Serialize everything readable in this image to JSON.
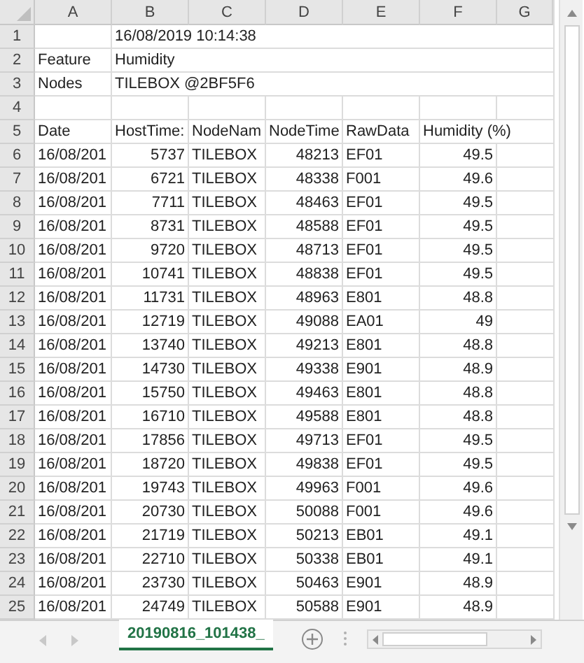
{
  "columns": [
    "A",
    "B",
    "C",
    "D",
    "E",
    "F",
    "G"
  ],
  "rows": [
    {
      "row": "1",
      "B": {
        "text": "16/08/2019 10:14:38",
        "kind": "text"
      }
    },
    {
      "row": "2",
      "A": {
        "text": "Feature",
        "kind": "text"
      },
      "B": {
        "text": "Humidity",
        "kind": "text"
      }
    },
    {
      "row": "3",
      "A": {
        "text": "Nodes",
        "kind": "text"
      },
      "B": {
        "text": "TILEBOX @2BF5F6",
        "kind": "text"
      }
    },
    {
      "row": "4"
    },
    {
      "row": "5",
      "A": {
        "text": "Date",
        "kind": "text"
      },
      "B": {
        "text": "HostTime:",
        "kind": "text"
      },
      "C": {
        "text": "NodeNam",
        "kind": "text"
      },
      "D": {
        "text": "NodeTime",
        "kind": "text"
      },
      "E": {
        "text": "RawData",
        "kind": "text"
      },
      "F": {
        "text": "Humidity (%)",
        "kind": "text"
      }
    },
    {
      "row": "6",
      "A": {
        "text": "16/08/201",
        "kind": "text"
      },
      "B": {
        "text": "5737",
        "kind": "number"
      },
      "C": {
        "text": "TILEBOX",
        "kind": "text"
      },
      "D": {
        "text": "48213",
        "kind": "number"
      },
      "E": {
        "text": "EF01",
        "kind": "text"
      },
      "F": {
        "text": "49.5",
        "kind": "number"
      }
    },
    {
      "row": "7",
      "A": {
        "text": "16/08/201",
        "kind": "text"
      },
      "B": {
        "text": "6721",
        "kind": "number"
      },
      "C": {
        "text": "TILEBOX",
        "kind": "text"
      },
      "D": {
        "text": "48338",
        "kind": "number"
      },
      "E": {
        "text": "F001",
        "kind": "text"
      },
      "F": {
        "text": "49.6",
        "kind": "number"
      }
    },
    {
      "row": "8",
      "A": {
        "text": "16/08/201",
        "kind": "text"
      },
      "B": {
        "text": "7711",
        "kind": "number"
      },
      "C": {
        "text": "TILEBOX",
        "kind": "text"
      },
      "D": {
        "text": "48463",
        "kind": "number"
      },
      "E": {
        "text": "EF01",
        "kind": "text"
      },
      "F": {
        "text": "49.5",
        "kind": "number"
      }
    },
    {
      "row": "9",
      "A": {
        "text": "16/08/201",
        "kind": "text"
      },
      "B": {
        "text": "8731",
        "kind": "number"
      },
      "C": {
        "text": "TILEBOX",
        "kind": "text"
      },
      "D": {
        "text": "48588",
        "kind": "number"
      },
      "E": {
        "text": "EF01",
        "kind": "text"
      },
      "F": {
        "text": "49.5",
        "kind": "number"
      }
    },
    {
      "row": "10",
      "A": {
        "text": "16/08/201",
        "kind": "text"
      },
      "B": {
        "text": "9720",
        "kind": "number"
      },
      "C": {
        "text": "TILEBOX",
        "kind": "text"
      },
      "D": {
        "text": "48713",
        "kind": "number"
      },
      "E": {
        "text": "EF01",
        "kind": "text"
      },
      "F": {
        "text": "49.5",
        "kind": "number"
      }
    },
    {
      "row": "11",
      "A": {
        "text": "16/08/201",
        "kind": "text"
      },
      "B": {
        "text": "10741",
        "kind": "number"
      },
      "C": {
        "text": "TILEBOX",
        "kind": "text"
      },
      "D": {
        "text": "48838",
        "kind": "number"
      },
      "E": {
        "text": "EF01",
        "kind": "text"
      },
      "F": {
        "text": "49.5",
        "kind": "number"
      }
    },
    {
      "row": "12",
      "A": {
        "text": "16/08/201",
        "kind": "text"
      },
      "B": {
        "text": "11731",
        "kind": "number"
      },
      "C": {
        "text": "TILEBOX",
        "kind": "text"
      },
      "D": {
        "text": "48963",
        "kind": "number"
      },
      "E": {
        "text": "E801",
        "kind": "text"
      },
      "F": {
        "text": "48.8",
        "kind": "number"
      }
    },
    {
      "row": "13",
      "A": {
        "text": "16/08/201",
        "kind": "text"
      },
      "B": {
        "text": "12719",
        "kind": "number"
      },
      "C": {
        "text": "TILEBOX",
        "kind": "text"
      },
      "D": {
        "text": "49088",
        "kind": "number"
      },
      "E": {
        "text": "EA01",
        "kind": "text"
      },
      "F": {
        "text": "49",
        "kind": "number"
      }
    },
    {
      "row": "14",
      "A": {
        "text": "16/08/201",
        "kind": "text"
      },
      "B": {
        "text": "13740",
        "kind": "number"
      },
      "C": {
        "text": "TILEBOX",
        "kind": "text"
      },
      "D": {
        "text": "49213",
        "kind": "number"
      },
      "E": {
        "text": "E801",
        "kind": "text"
      },
      "F": {
        "text": "48.8",
        "kind": "number"
      }
    },
    {
      "row": "15",
      "A": {
        "text": "16/08/201",
        "kind": "text"
      },
      "B": {
        "text": "14730",
        "kind": "number"
      },
      "C": {
        "text": "TILEBOX",
        "kind": "text"
      },
      "D": {
        "text": "49338",
        "kind": "number"
      },
      "E": {
        "text": "E901",
        "kind": "text"
      },
      "F": {
        "text": "48.9",
        "kind": "number"
      }
    },
    {
      "row": "16",
      "A": {
        "text": "16/08/201",
        "kind": "text"
      },
      "B": {
        "text": "15750",
        "kind": "number"
      },
      "C": {
        "text": "TILEBOX",
        "kind": "text"
      },
      "D": {
        "text": "49463",
        "kind": "number"
      },
      "E": {
        "text": "E801",
        "kind": "text"
      },
      "F": {
        "text": "48.8",
        "kind": "number"
      }
    },
    {
      "row": "17",
      "A": {
        "text": "16/08/201",
        "kind": "text"
      },
      "B": {
        "text": "16710",
        "kind": "number"
      },
      "C": {
        "text": "TILEBOX",
        "kind": "text"
      },
      "D": {
        "text": "49588",
        "kind": "number"
      },
      "E": {
        "text": "E801",
        "kind": "text"
      },
      "F": {
        "text": "48.8",
        "kind": "number"
      }
    },
    {
      "row": "18",
      "A": {
        "text": "16/08/201",
        "kind": "text"
      },
      "B": {
        "text": "17856",
        "kind": "number"
      },
      "C": {
        "text": "TILEBOX",
        "kind": "text"
      },
      "D": {
        "text": "49713",
        "kind": "number"
      },
      "E": {
        "text": "EF01",
        "kind": "text"
      },
      "F": {
        "text": "49.5",
        "kind": "number"
      }
    },
    {
      "row": "19",
      "A": {
        "text": "16/08/201",
        "kind": "text"
      },
      "B": {
        "text": "18720",
        "kind": "number"
      },
      "C": {
        "text": "TILEBOX",
        "kind": "text"
      },
      "D": {
        "text": "49838",
        "kind": "number"
      },
      "E": {
        "text": "EF01",
        "kind": "text"
      },
      "F": {
        "text": "49.5",
        "kind": "number"
      }
    },
    {
      "row": "20",
      "A": {
        "text": "16/08/201",
        "kind": "text"
      },
      "B": {
        "text": "19743",
        "kind": "number"
      },
      "C": {
        "text": "TILEBOX",
        "kind": "text"
      },
      "D": {
        "text": "49963",
        "kind": "number"
      },
      "E": {
        "text": "F001",
        "kind": "text"
      },
      "F": {
        "text": "49.6",
        "kind": "number"
      }
    },
    {
      "row": "21",
      "A": {
        "text": "16/08/201",
        "kind": "text"
      },
      "B": {
        "text": "20730",
        "kind": "number"
      },
      "C": {
        "text": "TILEBOX",
        "kind": "text"
      },
      "D": {
        "text": "50088",
        "kind": "number"
      },
      "E": {
        "text": "F001",
        "kind": "text"
      },
      "F": {
        "text": "49.6",
        "kind": "number"
      }
    },
    {
      "row": "22",
      "A": {
        "text": "16/08/201",
        "kind": "text"
      },
      "B": {
        "text": "21719",
        "kind": "number"
      },
      "C": {
        "text": "TILEBOX",
        "kind": "text"
      },
      "D": {
        "text": "50213",
        "kind": "number"
      },
      "E": {
        "text": "EB01",
        "kind": "text"
      },
      "F": {
        "text": "49.1",
        "kind": "number"
      }
    },
    {
      "row": "23",
      "A": {
        "text": "16/08/201",
        "kind": "text"
      },
      "B": {
        "text": "22710",
        "kind": "number"
      },
      "C": {
        "text": "TILEBOX",
        "kind": "text"
      },
      "D": {
        "text": "50338",
        "kind": "number"
      },
      "E": {
        "text": "EB01",
        "kind": "text"
      },
      "F": {
        "text": "49.1",
        "kind": "number"
      }
    },
    {
      "row": "24",
      "A": {
        "text": "16/08/201",
        "kind": "text"
      },
      "B": {
        "text": "23730",
        "kind": "number"
      },
      "C": {
        "text": "TILEBOX",
        "kind": "text"
      },
      "D": {
        "text": "50463",
        "kind": "number"
      },
      "E": {
        "text": "E901",
        "kind": "text"
      },
      "F": {
        "text": "48.9",
        "kind": "number"
      }
    },
    {
      "row": "25",
      "A": {
        "text": "16/08/201",
        "kind": "text"
      },
      "B": {
        "text": "24749",
        "kind": "number"
      },
      "C": {
        "text": "TILEBOX",
        "kind": "text"
      },
      "D": {
        "text": "50588",
        "kind": "number"
      },
      "E": {
        "text": "E901",
        "kind": "text"
      },
      "F": {
        "text": "48.9",
        "kind": "number"
      }
    }
  ],
  "sheet_tabs": [
    {
      "label": "20190816_101438_",
      "selected": true
    }
  ]
}
